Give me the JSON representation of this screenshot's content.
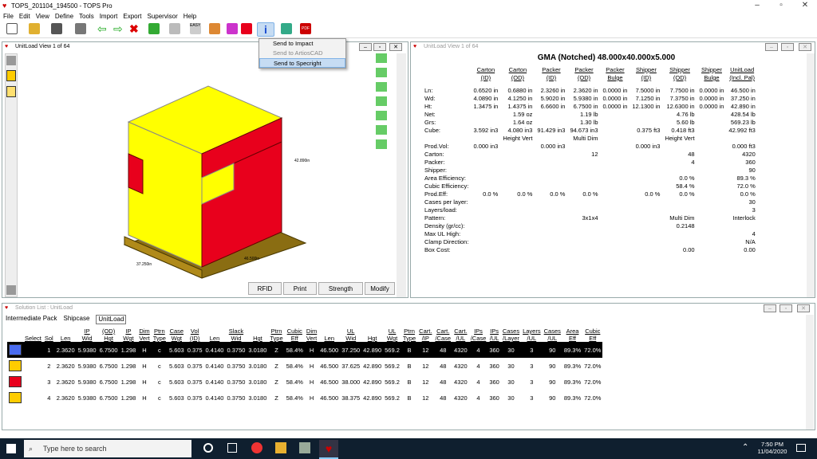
{
  "window": {
    "title": "TOPS_201104_194500 - TOPS Pro"
  },
  "menubar": [
    "File",
    "Edit",
    "View",
    "Define",
    "Tools",
    "Import",
    "Export",
    "Supervisor",
    "Help"
  ],
  "context_menu": [
    "Send to Impact",
    "Send to ArtiosCAD",
    "Send to Specright"
  ],
  "unitload_view": {
    "title": "UnitLoad View  1 of 64",
    "dim_height": "42.890in",
    "dim_width": "37.250in",
    "dim_length": "46.500in",
    "buttons": [
      "RFID",
      "Print",
      "Strength",
      "Modify"
    ]
  },
  "right_view": {
    "title": "UnitLoad View  1 of 64",
    "heading": "GMA (Notched) 48.000x40.000x5.000",
    "columns": [
      "Carton\n(ID)",
      "Carton\n(OD)",
      "Packer\n(ID)",
      "Packer\n(OD)",
      "Packer\nBulge",
      "Shipper\n(ID)",
      "Shipper\n(OD)",
      "Shipper\nBulge",
      "UnitLoad\n(Incl. Pal)"
    ],
    "rows": [
      [
        "Ln:",
        "0.6520 in",
        "0.6880 in",
        "2.3260 in",
        "2.3620 in",
        "0.0000 in",
        "7.5000 in",
        "7.7500 in",
        "0.0000 in",
        "46.500 in"
      ],
      [
        "Wd:",
        "4.0890 in",
        "4.1250 in",
        "5.9020 in",
        "5.9380 in",
        "0.0000 in",
        "7.1250 in",
        "7.3750 in",
        "0.0000 in",
        "37.250 in"
      ],
      [
        "Ht:",
        "1.3475 in",
        "1.4375 in",
        "6.6600 in",
        "6.7500 in",
        "0.0000 in",
        "12.1300 in",
        "12.6300 in",
        "0.0000 in",
        "42.890 in"
      ],
      [
        "Net:",
        "",
        "1.59 oz",
        "",
        "1.19 lb",
        "",
        "",
        "4.76 lb",
        "",
        "428.54 lb"
      ],
      [
        "Grs:",
        "",
        "1.64 oz",
        "",
        "1.30 lb",
        "",
        "",
        "5.60 lb",
        "",
        "569.23 lb"
      ],
      [
        "Cube:",
        "3.592 in3",
        "4.080 in3",
        "91.429 in3",
        "94.673 in3",
        "",
        "0.375 ft3",
        "0.418 ft3",
        "",
        "42.992 ft3"
      ],
      [
        "",
        "",
        "Height Vert",
        "",
        "Multi Dim",
        "",
        "",
        "Height Vert",
        "",
        ""
      ],
      [
        "Prod.Vol:",
        "0.000 in3",
        "",
        "0.000 in3",
        "",
        "",
        "0.000 in3",
        "",
        "",
        "0.000 ft3"
      ],
      [
        "Carton:",
        "",
        "",
        "",
        "12",
        "",
        "",
        "48",
        "",
        "4320"
      ],
      [
        "Packer:",
        "",
        "",
        "",
        "",
        "",
        "",
        "4",
        "",
        "360"
      ],
      [
        "Shipper:",
        "",
        "",
        "",
        "",
        "",
        "",
        "",
        "",
        "90"
      ],
      [
        "Area Efficiency:",
        "",
        "",
        "",
        "",
        "",
        "",
        "0.0 %",
        "",
        "89.3 %"
      ],
      [
        "Cubic Efficiency:",
        "",
        "",
        "",
        "",
        "",
        "",
        "58.4 %",
        "",
        "72.0 %"
      ],
      [
        "Prod.Eff:",
        "0.0 %",
        "0.0 %",
        "0.0 %",
        "0.0 %",
        "",
        "0.0 %",
        "0.0 %",
        "",
        "0.0 %"
      ],
      [
        "Cases per layer:",
        "",
        "",
        "",
        "",
        "",
        "",
        "",
        "",
        "30"
      ],
      [
        "Layers/load:",
        "",
        "",
        "",
        "",
        "",
        "",
        "",
        "",
        "3"
      ],
      [
        "Pattern:",
        "",
        "",
        "",
        "3x1x4",
        "",
        "",
        "Multi Dim",
        "",
        "Interlock"
      ],
      [
        "Density (gr/cc):",
        "",
        "",
        "",
        "",
        "",
        "",
        "0.2148",
        "",
        ""
      ],
      [
        "Max UL High:",
        "",
        "",
        "",
        "",
        "",
        "",
        "",
        "",
        "4"
      ],
      [
        "Clamp Direction:",
        "",
        "",
        "",
        "",
        "",
        "",
        "",
        "",
        "N/A"
      ],
      [
        "Box Cost:",
        "",
        "",
        "",
        "",
        "",
        "",
        "0.00",
        "",
        "0.00"
      ]
    ]
  },
  "solution_list": {
    "title": "Solution List : UnitLoad",
    "tabs": [
      "Intermediate Pack",
      "Shipcase",
      "UnitLoad"
    ],
    "columns": [
      "Select",
      "Sol",
      "Len",
      "IP\nWid",
      "(OD)\nHgt",
      "IP\nWgt",
      "Dim\nVert",
      "Ptrn\nType",
      "Case\nWgt",
      "Vol\n(ID)",
      "Len",
      "Slack\nWid",
      "Hgt",
      "Ptrn\nType",
      "Cubic\nEff",
      "Dim\nVert",
      "Len",
      "UL\nWid",
      "Hgt",
      "UL\nWgt",
      "Ptrn\nType",
      "Cart.\n/IP",
      "Cart.\n/Case",
      "Cart.\n/UL",
      "IPs\n/Case",
      "IPs\n/UL",
      "Cases\n/Layer",
      "Layers\n/UL",
      "Cases\n/UL",
      "Area\nEff",
      "Cubic\nEff"
    ],
    "rows": [
      [
        "",
        "1",
        "2.3620",
        "5.9380",
        "6.7500",
        "1.298",
        "H",
        "c",
        "5.603",
        "0.375",
        "0.4140",
        "0.3750",
        "3.0180",
        "Z",
        "58.4%",
        "H",
        "46.500",
        "37.250",
        "42.890",
        "569.2",
        "B",
        "12",
        "48",
        "4320",
        "4",
        "360",
        "30",
        "3",
        "90",
        "89.3%",
        "72.0%"
      ],
      [
        "",
        "2",
        "2.3620",
        "5.9380",
        "6.7500",
        "1.298",
        "H",
        "c",
        "5.603",
        "0.375",
        "0.4140",
        "0.3750",
        "3.0180",
        "Z",
        "58.4%",
        "H",
        "46.500",
        "37.625",
        "42.890",
        "569.2",
        "B",
        "12",
        "48",
        "4320",
        "4",
        "360",
        "30",
        "3",
        "90",
        "89.3%",
        "72.0%"
      ],
      [
        "",
        "3",
        "2.3620",
        "5.9380",
        "6.7500",
        "1.298",
        "H",
        "c",
        "5.603",
        "0.375",
        "0.4140",
        "0.3750",
        "3.0180",
        "Z",
        "58.4%",
        "H",
        "46.500",
        "38.000",
        "42.890",
        "569.2",
        "B",
        "12",
        "48",
        "4320",
        "4",
        "360",
        "30",
        "3",
        "90",
        "89.3%",
        "72.0%"
      ],
      [
        "",
        "4",
        "2.3620",
        "5.9380",
        "6.7500",
        "1.298",
        "H",
        "c",
        "5.603",
        "0.375",
        "0.4140",
        "0.3750",
        "3.0180",
        "Z",
        "58.4%",
        "H",
        "46.500",
        "38.375",
        "42.890",
        "569.2",
        "B",
        "12",
        "48",
        "4320",
        "4",
        "360",
        "30",
        "3",
        "90",
        "89.3%",
        "72.0%"
      ]
    ]
  },
  "taskbar": {
    "search_placeholder": "Type here to search",
    "time": "7:50 PM",
    "date": "11/04/2020"
  },
  "colors": {
    "red": "#e8001c",
    "yellow": "#ffff00",
    "pallet": "#8a6d12"
  }
}
